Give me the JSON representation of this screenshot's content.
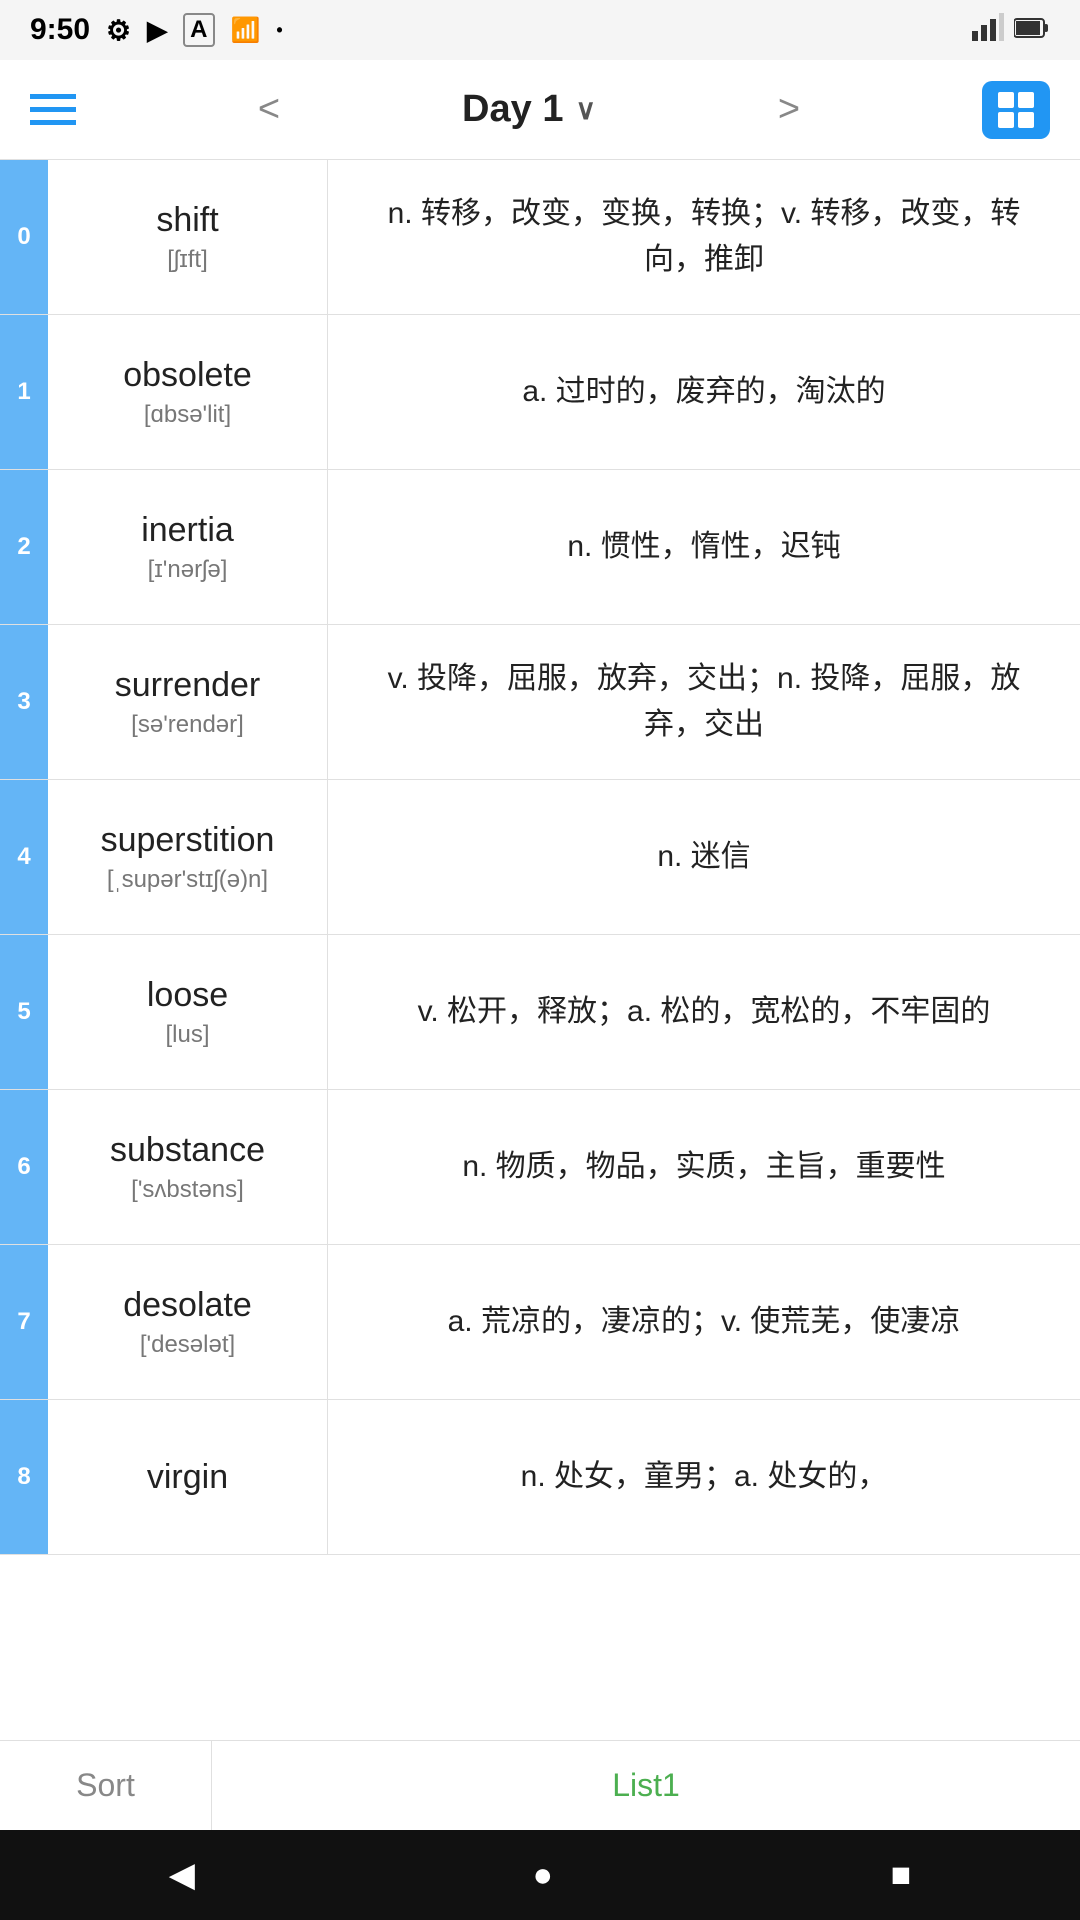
{
  "statusBar": {
    "time": "9:50",
    "icons": [
      "gear",
      "play",
      "font",
      "wifi",
      "signal",
      "battery"
    ]
  },
  "navBar": {
    "title": "Day 1",
    "prevLabel": "<",
    "nextLabel": ">",
    "gridIconAlt": "grid-view"
  },
  "words": [
    {
      "index": "0",
      "english": "shift",
      "phonetic": "[ʃɪft]",
      "definition": "n. 转移，改变，变换，转换；v. 转移，改变，转向，推卸"
    },
    {
      "index": "1",
      "english": "obsolete",
      "phonetic": "[ɑbsə'lit]",
      "definition": "a. 过时的，废弃的，淘汰的"
    },
    {
      "index": "2",
      "english": "inertia",
      "phonetic": "[ɪ'nərʃə]",
      "definition": "n. 惯性，惰性，迟钝"
    },
    {
      "index": "3",
      "english": "surrender",
      "phonetic": "[sə'rendər]",
      "definition": "v. 投降，屈服，放弃，交出；n. 投降，屈服，放弃，交出"
    },
    {
      "index": "4",
      "english": "superstition",
      "phonetic": "[ˌsupər'stɪʃ(ə)n]",
      "definition": "n. 迷信"
    },
    {
      "index": "5",
      "english": "loose",
      "phonetic": "[lus]",
      "definition": "v. 松开，释放；a. 松的，宽松的，不牢固的"
    },
    {
      "index": "6",
      "english": "substance",
      "phonetic": "['sʌbstəns]",
      "definition": "n. 物质，物品，实质，主旨，重要性"
    },
    {
      "index": "7",
      "english": "desolate",
      "phonetic": "['desələt]",
      "definition": "a. 荒凉的，凄凉的；v. 使荒芜，使凄凉"
    },
    {
      "index": "8",
      "english": "virgin",
      "phonetic": "",
      "definition": "n. 处女，童男；a. 处女的，"
    }
  ],
  "bottomTabs": {
    "sortLabel": "Sort",
    "list1Label": "List1"
  },
  "androidNav": {
    "backSymbol": "◀",
    "homeSymbol": "●",
    "recentSymbol": "■"
  }
}
